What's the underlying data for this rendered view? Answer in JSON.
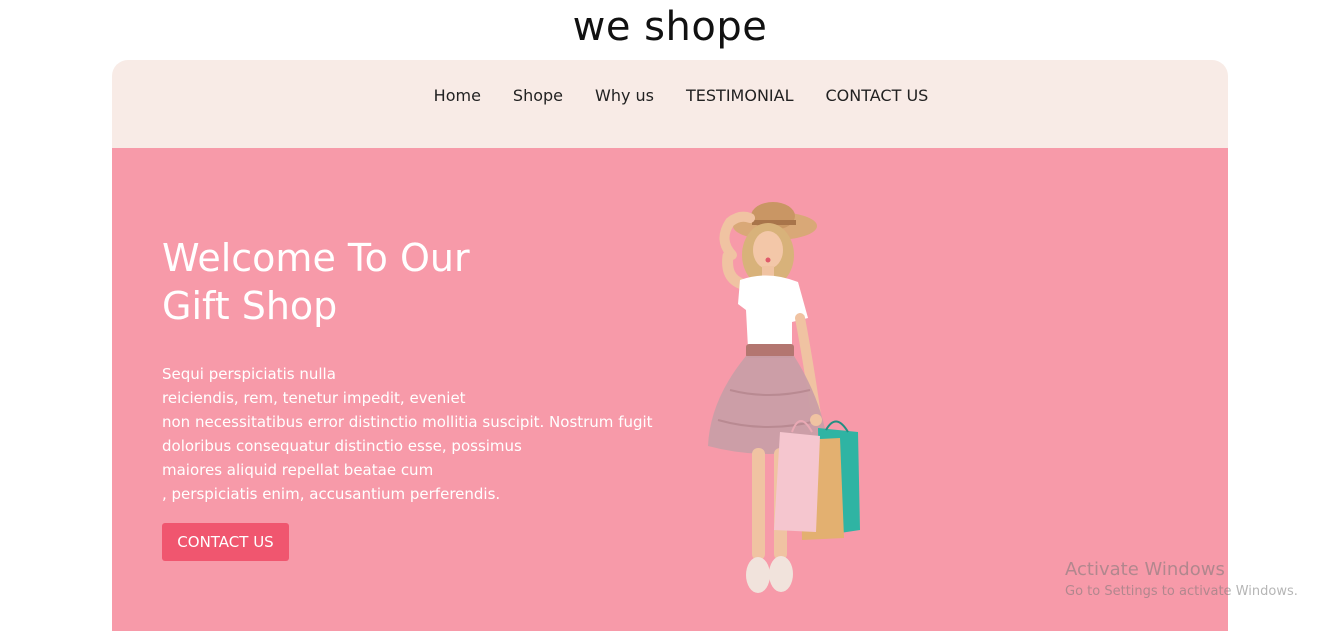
{
  "site": {
    "title": "we shope"
  },
  "nav": {
    "items": [
      {
        "label": "Home"
      },
      {
        "label": "Shope"
      },
      {
        "label": "Why us"
      },
      {
        "label": "TESTIMONIAL"
      },
      {
        "label": "CONTACT US"
      }
    ]
  },
  "hero": {
    "title_line1": "Welcome To Our",
    "title_line2": "Gift Shop",
    "description_lines": [
      "Sequi perspiciatis nulla",
      "reiciendis, rem, tenetur impedit, eveniet",
      "non necessitatibus error distinctio mollitia suscipit. Nostrum fugit",
      "doloribus consequatur distinctio esse, possimus",
      "maiores aliquid repellat beatae cum",
      ", perspiciatis enim, accusantium perferendis."
    ],
    "cta_label": "CONTACT US",
    "image_icon": "girl-with-shopping-bags-image"
  },
  "watermark": {
    "title": "Activate Windows",
    "subtitle": "Go to Settings to activate Windows."
  },
  "colors": {
    "nav_background": "#f8ebe6",
    "hero_background": "#f79aa9",
    "cta_background": "#f0566f",
    "text_light": "#ffffff",
    "text_dark": "#222222"
  }
}
